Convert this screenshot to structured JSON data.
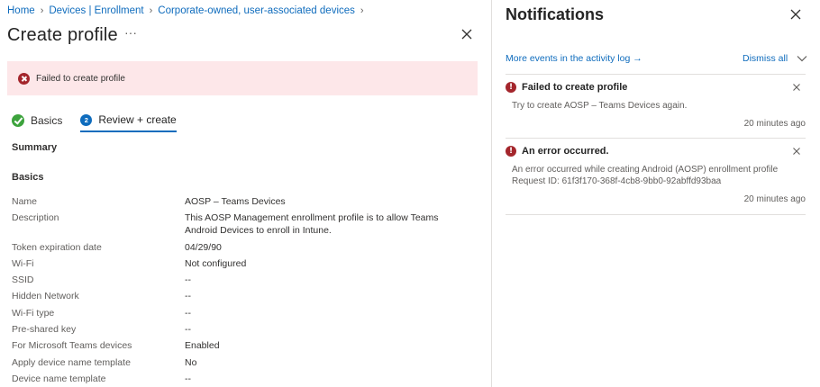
{
  "breadcrumb": [
    "Home",
    "Devices | Enrollment",
    "Corporate-owned, user-associated devices"
  ],
  "page": {
    "title": "Create profile",
    "more": "···"
  },
  "error_banner": {
    "text": "Failed to create profile"
  },
  "tabs": [
    {
      "label": "Basics",
      "state": "complete"
    },
    {
      "label": "Review + create",
      "number": "2",
      "state": "active"
    }
  ],
  "summary_heading": "Summary",
  "basics_heading": "Basics",
  "summary_rows": [
    {
      "key": "Name",
      "value": "AOSP – Teams Devices"
    },
    {
      "key": "Description",
      "value": "This AOSP Management enrollment profile is to allow Teams Android Devices to enroll in Intune."
    },
    {
      "key": "Token expiration date",
      "value": "04/29/90"
    },
    {
      "key": "Wi-Fi",
      "value": "Not configured"
    },
    {
      "key": "SSID",
      "value": "--"
    },
    {
      "key": "Hidden Network",
      "value": "--"
    },
    {
      "key": "Wi-Fi type",
      "value": "--"
    },
    {
      "key": "Pre-shared key",
      "value": "--"
    },
    {
      "key": "For Microsoft Teams devices",
      "value": "Enabled"
    },
    {
      "key": "Apply device name template",
      "value": "No"
    },
    {
      "key": "Device name template",
      "value": "--"
    }
  ],
  "notifications": {
    "title": "Notifications",
    "activity_link": "More events in the activity log →",
    "dismiss_all": "Dismiss all",
    "items": [
      {
        "title": "Failed to create profile",
        "body": "Try to create AOSP – Teams Devices again.",
        "time": "20 minutes ago",
        "status": "error"
      },
      {
        "title": "An error occurred.",
        "body": "An error occurred while creating Android (AOSP) enrollment profile",
        "request": "Request ID: 61f3f170-368f-4cb8-9bb0-92abffd93baa",
        "time": "20 minutes ago",
        "status": "error"
      }
    ]
  },
  "colors": {
    "link": "#0f6cbd",
    "error": "#a4262c",
    "error_bg": "#fde7e9",
    "success": "#3da33d"
  }
}
